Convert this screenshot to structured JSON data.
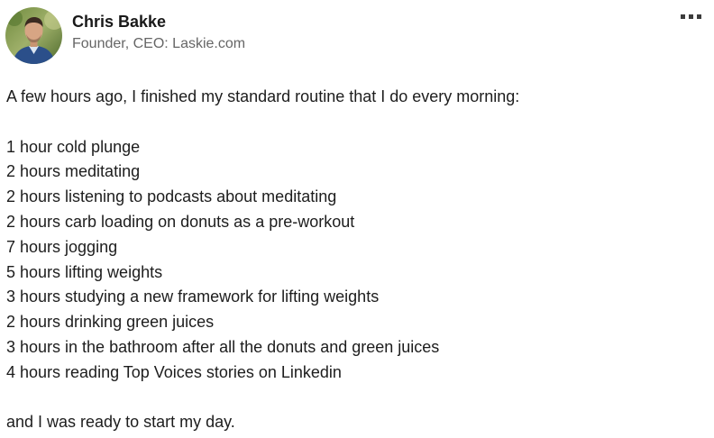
{
  "author": {
    "name": "Chris Bakke",
    "headline": "Founder, CEO: Laskie.com",
    "avatar_icon": "profile-photo"
  },
  "menu": {
    "icon": "more-options-icon"
  },
  "post": {
    "intro": "A few hours ago, I finished my standard routine that I do every morning:",
    "routine": [
      "1 hour cold plunge",
      "2 hours meditating",
      "2 hours listening to podcasts about meditating",
      "2 hours carb loading on donuts as a pre-workout",
      "7 hours jogging",
      "5 hours lifting weights",
      "3 hours studying a new framework for lifting weights",
      "2 hours drinking green juices",
      "3 hours in the bathroom after all the donuts and green juices",
      "4 hours reading Top Voices stories on Linkedin"
    ],
    "closing": "and I was ready to start my day."
  }
}
